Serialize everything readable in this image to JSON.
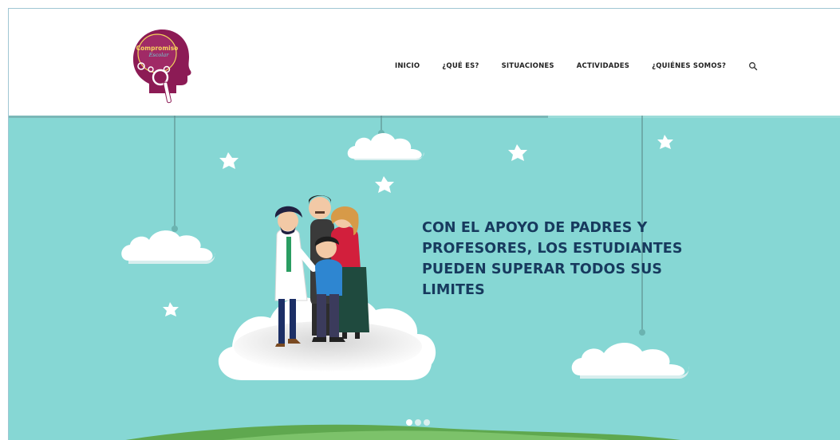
{
  "brand": {
    "logo_text_line1": "Compromiso",
    "logo_text_line2": "Escolar",
    "colors": {
      "primary": "#8c1b55",
      "accent": "#f2c94c"
    }
  },
  "nav": {
    "items": [
      "INICIO",
      "¿QUÉ ES?",
      "SITUACIONES",
      "ACTIVIDADES",
      "¿QUIÉNES SOMOS?"
    ],
    "search_icon": "search-icon"
  },
  "hero": {
    "headline": "CON EL APOYO DE PADRES Y PROFESORES, LOS ESTUDIANTES PUEDEN SUPERAR TODOS SUS LIMITES",
    "background": "#86d7d4",
    "headline_color": "#173a5e",
    "slides": 3,
    "active_slide": 1
  }
}
